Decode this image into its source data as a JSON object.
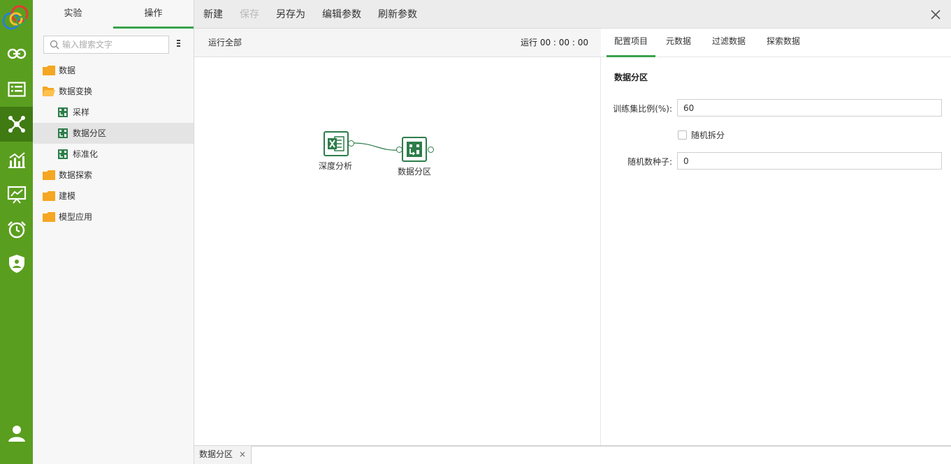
{
  "sidebar": {
    "tabs": [
      {
        "label": "实验",
        "active": false
      },
      {
        "label": "操作",
        "active": true
      }
    ],
    "search": {
      "placeholder": "输入搜索文字",
      "value": ""
    },
    "tree": [
      {
        "label": "数据",
        "type": "folder",
        "expanded": false
      },
      {
        "label": "数据变换",
        "type": "folder",
        "expanded": true
      },
      {
        "label": "采样",
        "type": "operator"
      },
      {
        "label": "数据分区",
        "type": "operator",
        "selected": true
      },
      {
        "label": "标准化",
        "type": "operator"
      },
      {
        "label": "数据探索",
        "type": "folder",
        "expanded": false
      },
      {
        "label": "建模",
        "type": "folder",
        "expanded": false
      },
      {
        "label": "模型应用",
        "type": "folder",
        "expanded": false
      }
    ]
  },
  "rail": {
    "icons": [
      "link-icon",
      "list-icon",
      "network-icon",
      "chart-icon",
      "presentation-icon",
      "alarm-clock-icon",
      "shield-icon",
      "user-icon"
    ],
    "active": "network-icon"
  },
  "toolbar": {
    "new_label": "新建",
    "save_label": "保存",
    "save_as_label": "另存为",
    "edit_params_label": "编辑参数",
    "refresh_params_label": "刷新参数"
  },
  "canvas": {
    "run_all_label": "运行全部",
    "run_timer": "运行 00 : 00 : 00",
    "nodes": [
      {
        "label": "深度分析",
        "icon": "excel-icon"
      },
      {
        "label": "数据分区",
        "icon": "partition-icon"
      }
    ]
  },
  "config": {
    "tabs": [
      {
        "label": "配置项目",
        "active": true
      },
      {
        "label": "元数据",
        "active": false
      },
      {
        "label": "过滤数据",
        "active": false
      },
      {
        "label": "探索数据",
        "active": false
      }
    ],
    "section_title": "数据分区",
    "train_ratio_label": "训练集比例(%):",
    "train_ratio_value": "60",
    "random_split_label": "随机拆分",
    "random_split_checked": false,
    "seed_label": "随机数种子:",
    "seed_value": "0"
  },
  "bottom": {
    "tab_label": "数据分区",
    "close_glyph": "×"
  },
  "colors": {
    "rail": "#5a9e1f",
    "rail_active": "#3f7a12",
    "accent": "#3aa24d",
    "folder": "#f5a623",
    "node_border": "#2e7d4a"
  }
}
